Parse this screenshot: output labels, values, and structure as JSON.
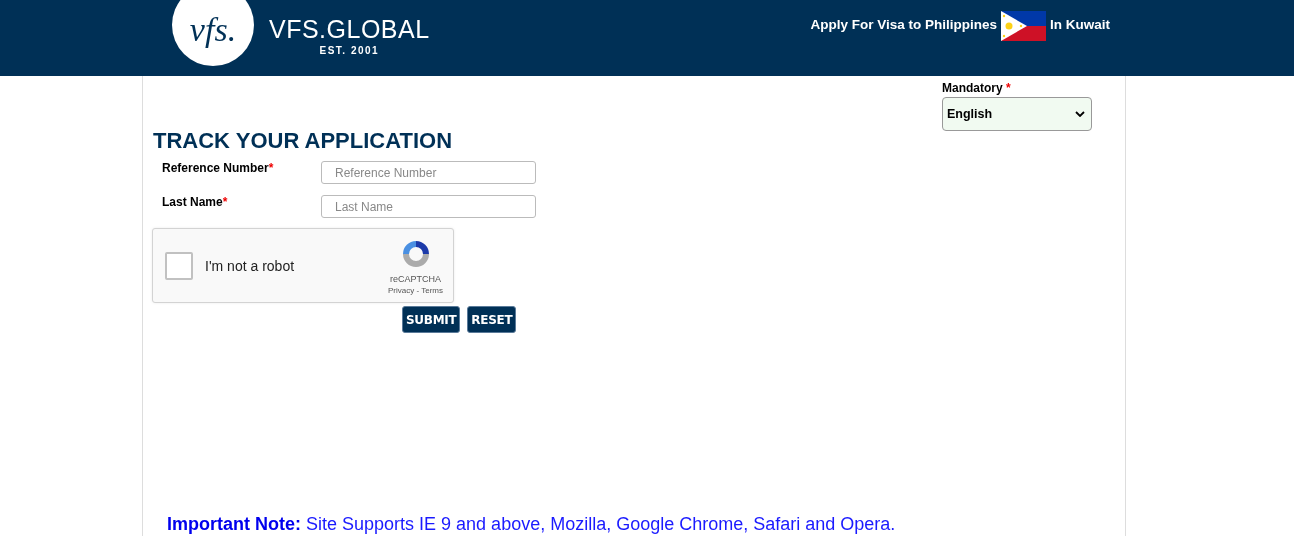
{
  "header": {
    "logo_mark": "vfs.",
    "logo_name": "VFS.GLOBAL",
    "logo_tagline": "EST. 2001",
    "apply_text": "Apply For Visa to Philippines",
    "location_text": "In Kuwait"
  },
  "language": {
    "label": "Mandatory",
    "required_mark": "*",
    "value": "English"
  },
  "title": "TRACK YOUR APPLICATION",
  "fields": [
    {
      "label": "Reference Number",
      "required_mark": "*",
      "placeholder": "Reference Number"
    },
    {
      "label": "Last Name",
      "required_mark": "*",
      "placeholder": "Last Name"
    }
  ],
  "captcha": {
    "label": "I'm not a robot",
    "checked": false,
    "brand": "reCAPTCHA",
    "links": "Privacy - Terms"
  },
  "buttons": [
    "SUBMIT",
    "RESET"
  ],
  "note": "**Important Note:** Site Supports IE 9 and above, Mozilla, Google Chrome, Safari and Opera."
}
